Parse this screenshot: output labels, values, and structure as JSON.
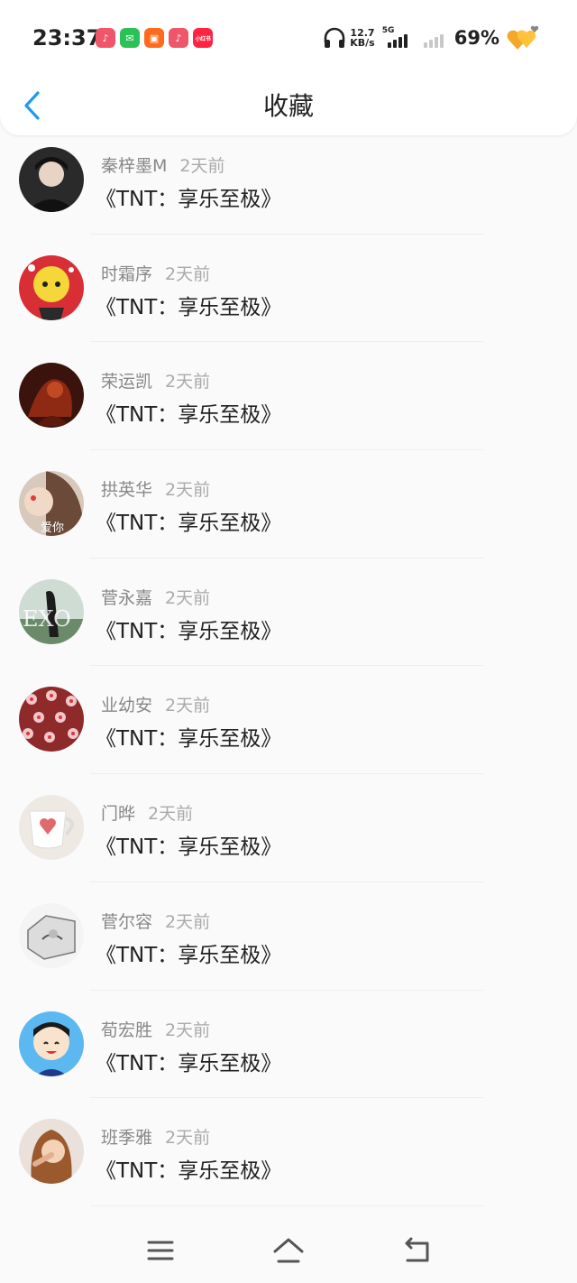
{
  "status_bar": {
    "time": "23:37",
    "net_speed_value": "12.7",
    "net_speed_unit": "KB/s",
    "network_type": "5G",
    "battery_percent": "69%",
    "app_icons": [
      {
        "name": "douyin-icon",
        "glyph": "♪",
        "color": "#f0566a"
      },
      {
        "name": "wechat-icon",
        "glyph": "✉",
        "color": "#2bc157"
      },
      {
        "name": "kuaishou-icon",
        "glyph": "▣",
        "color": "#ff6a1c"
      },
      {
        "name": "douyin-icon",
        "glyph": "♪",
        "color": "#f0566a"
      },
      {
        "name": "xiaohongshu-icon",
        "glyph": "小红书",
        "color": "#ff2442"
      }
    ]
  },
  "header": {
    "title": "收藏",
    "back_icon": "chevron-left-icon",
    "accent": "#1e9bef"
  },
  "items": [
    {
      "user": "秦梓墨M",
      "time": "2天前",
      "title": "《TNT：享乐至极》"
    },
    {
      "user": "时霜序",
      "time": "2天前",
      "title": "《TNT：享乐至极》"
    },
    {
      "user": "荣运凯",
      "time": "2天前",
      "title": "《TNT：享乐至极》"
    },
    {
      "user": "拱英华",
      "time": "2天前",
      "title": "《TNT：享乐至极》",
      "avatar_text": "爱你"
    },
    {
      "user": "菅永嘉",
      "time": "2天前",
      "title": "《TNT：享乐至极》",
      "avatar_text": "EXO"
    },
    {
      "user": "业幼安",
      "time": "2天前",
      "title": "《TNT：享乐至极》"
    },
    {
      "user": "门晔",
      "time": "2天前",
      "title": "《TNT：享乐至极》"
    },
    {
      "user": "菅尔容",
      "time": "2天前",
      "title": "《TNT：享乐至极》"
    },
    {
      "user": "荀宏胜",
      "time": "2天前",
      "title": "《TNT：享乐至极》"
    },
    {
      "user": "班季雅",
      "time": "2天前",
      "title": "《TNT：享乐至极》"
    }
  ],
  "nav_bar": {
    "buttons": [
      "menu-icon",
      "home-icon",
      "back-icon"
    ]
  }
}
